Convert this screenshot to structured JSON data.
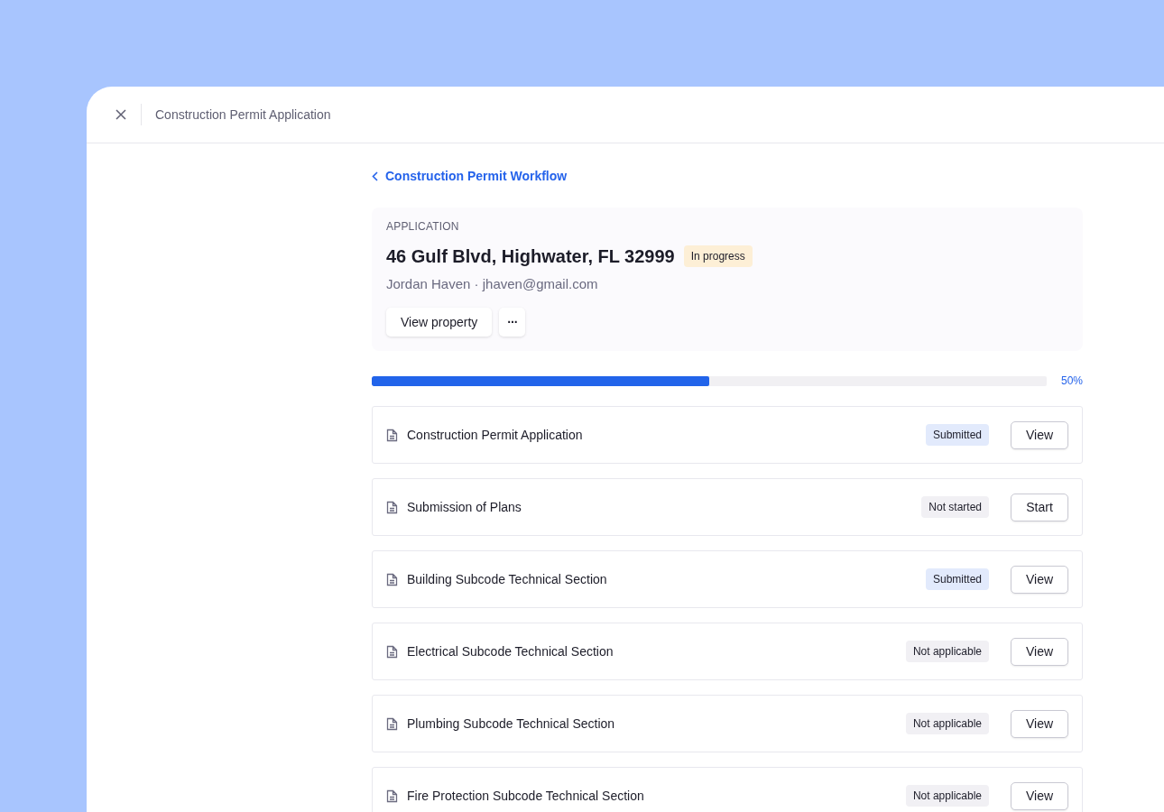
{
  "window": {
    "title": "Construction Permit Application"
  },
  "back_link": {
    "label": "Construction Permit Workflow"
  },
  "application": {
    "eyebrow": "APPLICATION",
    "address": "46 Gulf Blvd, Highwater, FL 32999",
    "status": {
      "label": "In progress",
      "kind": "in_progress"
    },
    "contact": "Jordan Haven · jhaven@gmail.com",
    "primary_button": "View property",
    "more_button": "···"
  },
  "progress": {
    "level": 0.5,
    "reading": "50%"
  },
  "tasks": [
    {
      "name": "Construction Permit Application",
      "status": {
        "label": "Submitted",
        "kind": "submitted"
      },
      "action": "View"
    },
    {
      "name": "Submission of Plans",
      "status": {
        "label": "Not started",
        "kind": "neutral"
      },
      "action": "Start"
    },
    {
      "name": "Building Subcode Technical Section",
      "status": {
        "label": "Submitted",
        "kind": "submitted"
      },
      "action": "View"
    },
    {
      "name": "Electrical Subcode Technical Section",
      "status": {
        "label": "Not applicable",
        "kind": "neutral"
      },
      "action": "View"
    },
    {
      "name": "Plumbing Subcode Technical Section",
      "status": {
        "label": "Not applicable",
        "kind": "neutral"
      },
      "action": "View"
    },
    {
      "name": "Fire Protection Subcode Technical Section",
      "status": {
        "label": "Not applicable",
        "kind": "neutral"
      },
      "action": "View"
    }
  ]
}
